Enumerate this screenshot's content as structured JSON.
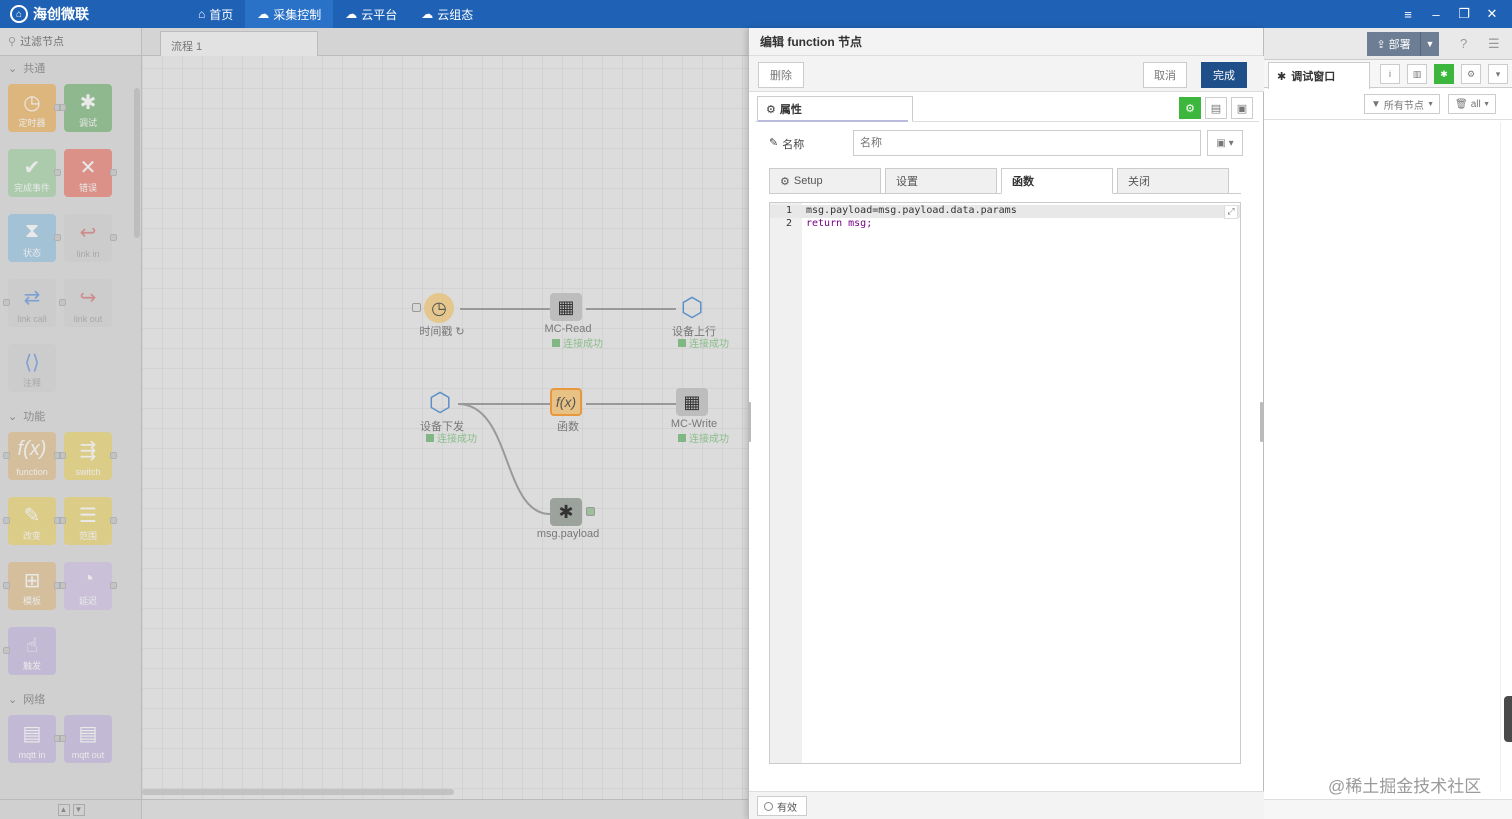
{
  "app": {
    "brand": "海创微联",
    "nav": [
      {
        "label": "首页",
        "icon": "home-icon"
      },
      {
        "label": "采集控制",
        "icon": "cloud-sync-icon"
      },
      {
        "label": "云平台",
        "icon": "cloud-icon"
      },
      {
        "label": "云组态",
        "icon": "cloud-icon"
      }
    ],
    "window_controls": [
      "≡",
      "–",
      "❐",
      "✕"
    ]
  },
  "palette": {
    "search_placeholder": "过滤节点",
    "categories": [
      {
        "name": "共通",
        "nodes": [
          "定时器",
          "调试",
          "完成事件",
          "错误",
          "状态",
          "link in",
          "link call",
          "link out",
          "注释"
        ]
      },
      {
        "name": "功能",
        "nodes": [
          "function",
          "switch",
          "改变",
          "范围",
          "模板",
          "延迟",
          "触发"
        ]
      },
      {
        "name": "网络",
        "nodes": [
          "mqtt in",
          "mqtt out"
        ]
      }
    ]
  },
  "workspace": {
    "tab": "流程 1",
    "nodes": [
      {
        "label": "时间戳 ↻"
      },
      {
        "label": "MC-Read",
        "status": "连接成功"
      },
      {
        "label": "设备上行",
        "status": "连接成功"
      },
      {
        "label": "设备下发",
        "status": "连接成功"
      },
      {
        "label": "函数"
      },
      {
        "label": "MC-Write",
        "status": "连接成功"
      },
      {
        "label": "msg.payload"
      }
    ]
  },
  "editor": {
    "title": "编辑 function 节点",
    "delete": "删除",
    "cancel": "取消",
    "done": "完成",
    "properties_tab": "属性",
    "name_label": "名称",
    "name_placeholder": "名称",
    "tabs": [
      "Setup",
      "设置",
      "函数",
      "关闭"
    ],
    "active_tab": "函数",
    "code": [
      "msg.payload=msg.payload.data.params",
      "return msg;"
    ],
    "valid": "有效"
  },
  "sidebar": {
    "deploy": "部署",
    "debug_tab": "调试窗口",
    "filter_nodes": "所有节点",
    "filter_all": "all"
  },
  "watermark": "@稀土掘金技术社区"
}
